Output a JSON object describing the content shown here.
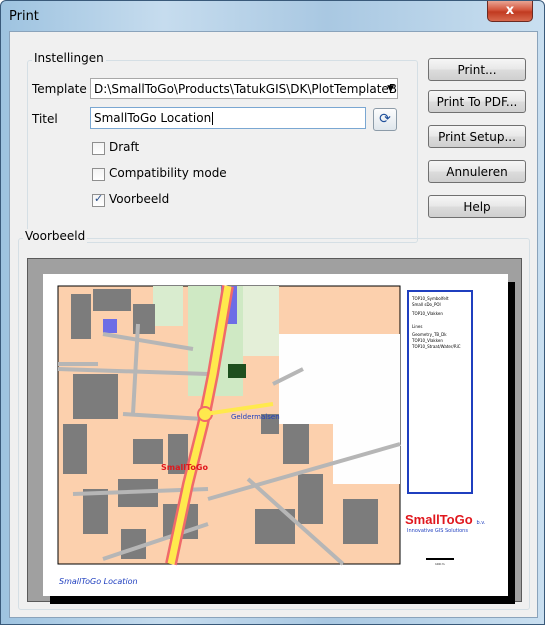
{
  "window": {
    "title": "Print",
    "close_glyph": "x"
  },
  "settings": {
    "group_label": "Instellingen",
    "template_label": "Template",
    "template_value": "D:\\SmallToGo\\Products\\TatukGIS\\DK\\PlotTemplateBui",
    "title_label": "Titel",
    "title_value": "SmallToGo Location",
    "draft_label": "Draft",
    "draft_checked": false,
    "compat_label": "Compatibility mode",
    "compat_checked": false,
    "preview_label": "Voorbeeld",
    "preview_checked": true
  },
  "buttons": {
    "print": "Print...",
    "print_pdf": "Print To PDF...",
    "print_setup": "Print Setup...",
    "cancel": "Annuleren",
    "help": "Help"
  },
  "preview": {
    "group_label": "Voorbeeld",
    "map_label": "Geldermalsen",
    "map_logo": "SmallToGo",
    "logo_text": "SmallToGo",
    "logo_suffix": "b.v.",
    "logo_tagline": "Innovative GIS Solutions",
    "scale_text": "100 m",
    "page_title": "SmallToGo Location",
    "legend_items": [
      "TOP10_Symbolfelt",
      "Small sDo_POI",
      "TOP10_Vlakken",
      "Lines",
      "Geometry_TB_Dk",
      "TOP10_Vlakken",
      "TOP10_Straat/Water/RiC"
    ]
  },
  "colors": {
    "accent_blue": "#1f3fbf",
    "logo_red": "#e0171d",
    "road_yellow": "#ffe94d",
    "road_red": "#f06a6a",
    "building": "#7c7c7c",
    "ground": "#fcd0ad"
  }
}
